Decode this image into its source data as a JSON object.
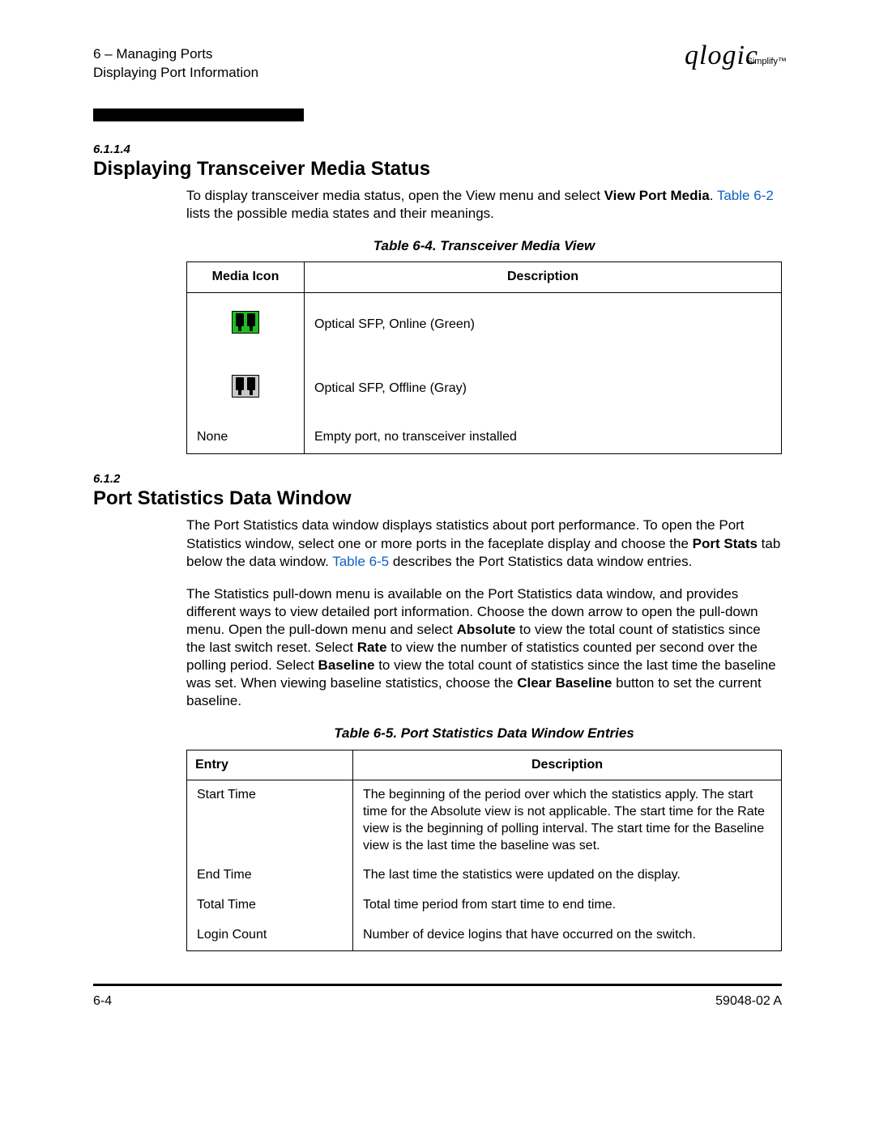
{
  "header": {
    "chapter_line": "6 – Managing Ports",
    "sub_line": "Displaying Port Information",
    "logo_script": "qlogic",
    "logo_tag": "Simplify™"
  },
  "sec1": {
    "num": "6.1.1.4",
    "title": "Displaying Transceiver Media Status",
    "para_a": "To display transceiver media status, open the View menu and select ",
    "para_bold": "View Port Media",
    "para_b": ". ",
    "para_link": "Table 6-2",
    "para_c": " lists the possible media states and their meanings.",
    "table_caption": "Table 6-4. Transceiver Media View",
    "th1": "Media Icon",
    "th2": "Description",
    "row1_icon_name": "sfp-online-icon",
    "row1_desc": "Optical SFP, Online (Green)",
    "row2_icon_name": "sfp-offline-icon",
    "row2_desc": "Optical SFP, Offline (Gray)",
    "row3_icon": "None",
    "row3_desc": "Empty port, no transceiver installed"
  },
  "sec2": {
    "num": "6.1.2",
    "title": "Port Statistics Data Window",
    "p1_a": "The Port Statistics data window displays statistics about port performance. To open the Port Statistics window, select one or more ports in the faceplate display and choose the ",
    "p1_bold": "Port Stats",
    "p1_b": " tab below the data window. ",
    "p1_link": "Table 6-5",
    "p1_c": " describes the Port Statistics data window entries.",
    "p2_a": "The Statistics pull-down menu is available on the Port Statistics data window, and provides different ways to view detailed port information. Choose the down arrow to open the pull-down menu. Open the pull-down menu and select ",
    "p2_b1": "Absolute",
    "p2_b": " to view the total count of statistics since the last switch reset. Select ",
    "p2_b2": "Rate",
    "p2_c": " to view the number of statistics counted per second over the polling period. Select ",
    "p2_b3": "Baseline",
    "p2_d": " to view the total count of statistics since the last time the baseline was set. When viewing baseline statistics, choose the ",
    "p2_b4": "Clear Baseline",
    "p2_e": " button to set the current baseline.",
    "table_caption": "Table 6-5. Port Statistics Data Window Entries",
    "th1": "Entry",
    "th2": "Description",
    "rows": [
      {
        "entry": "Start Time",
        "desc": "The beginning of the period over which the statistics apply. The start time for the Absolute view is not applicable. The start time for the Rate view is the beginning of polling interval. The start time for the Baseline view is the last time the baseline was set."
      },
      {
        "entry": "End Time",
        "desc": "The last time the statistics were updated on the display."
      },
      {
        "entry": "Total Time",
        "desc": "Total time period from start time to end time."
      },
      {
        "entry": "Login Count",
        "desc": "Number of device logins that have occurred on the switch."
      }
    ]
  },
  "footer": {
    "left": "6-4",
    "right": "59048-02 A"
  }
}
